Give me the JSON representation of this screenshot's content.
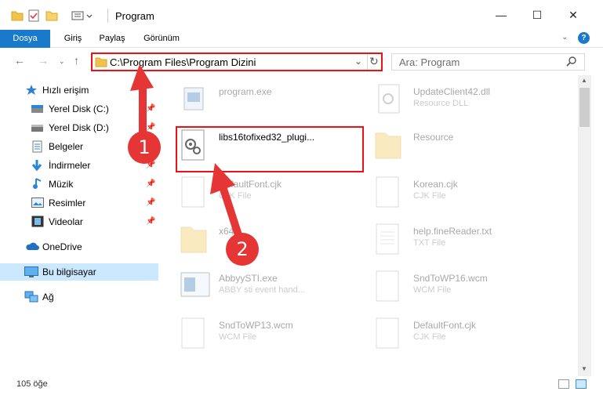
{
  "window": {
    "title": "Program",
    "minimize_glyph": "—",
    "maximize_glyph": "☐",
    "close_glyph": "✕"
  },
  "ribbon": {
    "tabs": [
      "Dosya",
      "Giriş",
      "Paylaş",
      "Görünüm"
    ]
  },
  "address": {
    "path": "C:\\Program Files\\Program Dizini"
  },
  "search": {
    "placeholder": "Ara: Program"
  },
  "sidebar": {
    "items": [
      {
        "label": "Hızlı erişim",
        "icon": "star-icon"
      },
      {
        "label": "Yerel Disk (C:)",
        "icon": "drive-icon",
        "pinned": true
      },
      {
        "label": "Yerel Disk (D:)",
        "icon": "drive-icon",
        "pinned": true
      },
      {
        "label": "Belgeler",
        "icon": "documents-icon",
        "pinned": true
      },
      {
        "label": "İndirmeler",
        "icon": "download-icon",
        "pinned": true
      },
      {
        "label": "Müzik",
        "icon": "music-icon",
        "pinned": true
      },
      {
        "label": "Resimler",
        "icon": "pictures-icon",
        "pinned": true
      },
      {
        "label": "Videolar",
        "icon": "videos-icon",
        "pinned": true
      },
      {
        "label": "OneDrive",
        "icon": "cloud-icon"
      },
      {
        "label": "Bu bilgisayar",
        "icon": "computer-icon",
        "selected": true
      },
      {
        "label": "Ağ",
        "icon": "network-icon"
      }
    ]
  },
  "files": [
    {
      "name": "program.exe",
      "type": "",
      "icon": "exe-icon",
      "col": 0,
      "row": 0,
      "faded": true
    },
    {
      "name": "UpdateClient42.dll",
      "type": "Resource DLL",
      "icon": "dll-icon",
      "col": 1,
      "row": 0,
      "faded": true
    },
    {
      "name": "libs16tofixed32_plugi...",
      "type": "",
      "icon": "gear-file-icon",
      "col": 0,
      "row": 1,
      "faded": false
    },
    {
      "name": "Resource",
      "type": "",
      "icon": "folder-icon",
      "col": 1,
      "row": 1,
      "faded": true
    },
    {
      "name": "DefaultFont.cjk",
      "type": "CJK File",
      "icon": "file-icon",
      "col": 0,
      "row": 2,
      "faded": true
    },
    {
      "name": "Korean.cjk",
      "type": "CJK File",
      "icon": "file-icon",
      "col": 1,
      "row": 2,
      "faded": true
    },
    {
      "name": "x64",
      "type": "",
      "icon": "folder-icon",
      "col": 0,
      "row": 3,
      "faded": true
    },
    {
      "name": "help.fineReader.txt",
      "type": "TXT File",
      "icon": "txt-icon",
      "col": 1,
      "row": 3,
      "faded": true
    },
    {
      "name": "AbbyySTI.exe",
      "type": "ABBY sti event hand...",
      "icon": "app-icon",
      "col": 0,
      "row": 4,
      "faded": true
    },
    {
      "name": "SndToWP16.wcm",
      "type": "WCM File",
      "icon": "file-icon",
      "col": 1,
      "row": 4,
      "faded": true
    },
    {
      "name": "SndToWP13.wcm",
      "type": "WCM File",
      "icon": "file-icon",
      "col": 0,
      "row": 5,
      "faded": true
    },
    {
      "name": "DefaultFont.cjk",
      "type": "CJK File",
      "icon": "file-icon",
      "col": 1,
      "row": 5,
      "faded": true
    }
  ],
  "status": {
    "item_count": "105 öğe"
  },
  "markers": [
    "1",
    "2"
  ],
  "colors": {
    "accent": "#1979ca",
    "highlight": "#e11111",
    "marker": "#e53535",
    "selected": "#cce8ff"
  }
}
